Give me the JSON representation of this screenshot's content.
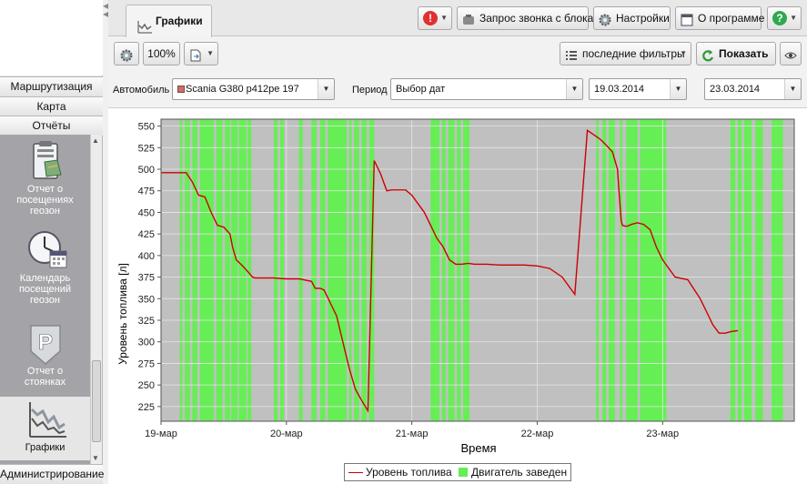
{
  "sidebar": {
    "sections": [
      "Маршрутизация",
      "Карта",
      "Отчёты"
    ],
    "items": [
      {
        "label": "Отчет о посещениях геозон",
        "icon": "clipboard-map-icon"
      },
      {
        "label": "Календарь посещений геозон",
        "icon": "clock-calendar-icon"
      },
      {
        "label": "Отчет о стоянках",
        "icon": "parking-sign-icon"
      },
      {
        "label": "Графики",
        "icon": "line-chart-icon"
      }
    ],
    "bottom_section": "Администрирование"
  },
  "tabs": [
    {
      "label": "Графики",
      "icon": "chart-icon"
    }
  ],
  "top_toolbar": {
    "alert_icon": "red-exclamation-icon",
    "call_request_label": "Запрос звонка с блока",
    "settings_label": "Настройки",
    "about_label": "О программе",
    "help_icon": "green-question-icon"
  },
  "chart_toolbar": {
    "settings_icon": "gear-icon",
    "zoom_label": "100%",
    "export_icon": "export-document-icon",
    "filters_label": "последние фильтры",
    "show_label": "Показать",
    "view_icon": "eye-icon"
  },
  "filters": {
    "vehicle_label": "Автомобиль",
    "vehicle_value": "Scania G380 p412pe 197",
    "vehicle_color": "#c87070",
    "period_label": "Период",
    "period_value": "Выбор дат",
    "date_from": "19.03.2014",
    "date_to": "23.03.2014"
  },
  "legend": {
    "fuel_label": "Уровень топлива",
    "engine_label": "Двигатель заведен"
  },
  "chart_data": {
    "type": "line",
    "xlabel": "Время",
    "ylabel": "Уровень топлива [л]",
    "x_ticks": [
      "19-мар",
      "20-мар",
      "21-мар",
      "22-мар",
      "23-мар"
    ],
    "y_ticks": [
      225,
      250,
      275,
      300,
      325,
      350,
      375,
      400,
      425,
      450,
      475,
      500,
      525,
      550
    ],
    "xlim_days": [
      0,
      5.05
    ],
    "ylim": [
      208,
      558
    ],
    "grid": true,
    "colors": {
      "fuel": "#cc0000",
      "engine": "#66ee55",
      "background": "#c0c0c0"
    },
    "series": [
      {
        "name": "Уровень топлива",
        "x_days": [
          0,
          0.2,
          0.25,
          0.3,
          0.35,
          0.4,
          0.45,
          0.5,
          0.55,
          0.57,
          0.6,
          0.65,
          0.7,
          0.73,
          0.75,
          0.8,
          0.85,
          0.9,
          1.0,
          1.1,
          1.2,
          1.23,
          1.27,
          1.3,
          1.35,
          1.4,
          1.45,
          1.5,
          1.55,
          1.6,
          1.65,
          1.7,
          1.75,
          1.8,
          1.84,
          1.846,
          1.85,
          1.87,
          1.9,
          1.95,
          2.0,
          2.1,
          2.2,
          2.25,
          2.3,
          2.35,
          2.4,
          2.45,
          2.5,
          2.55,
          2.6,
          2.7,
          2.8,
          2.9,
          3.0,
          3.1,
          3.2,
          3.3,
          3.4,
          3.5,
          3.55,
          3.6,
          3.64,
          3.65,
          3.66,
          3.67,
          3.68,
          3.7,
          3.72,
          3.75,
          3.8,
          3.85,
          3.9,
          3.95,
          4.0,
          4.1,
          4.2,
          4.3,
          4.35,
          4.4,
          4.45,
          4.5,
          4.55,
          4.6,
          4.65,
          4.7,
          4.75,
          4.8,
          4.85,
          4.88,
          4.95,
          5.0
        ],
        "y": [
          496,
          496,
          485,
          470,
          468,
          450,
          435,
          433,
          425,
          410,
          395,
          388,
          380,
          375,
          374,
          374,
          374,
          374,
          373,
          373,
          370,
          362,
          362,
          360,
          345,
          330,
          300,
          270,
          245,
          232,
          220,
          510,
          495,
          475,
          476,
          476,
          476,
          476,
          476,
          476,
          470,
          450,
          420,
          410,
          395,
          390,
          390,
          391,
          390,
          390,
          390,
          389,
          389,
          389,
          388,
          385,
          375,
          355,
          545,
          535,
          528,
          520,
          500,
          480,
          460,
          440,
          435,
          434,
          434,
          436,
          438,
          436,
          430,
          410,
          395,
          375,
          372,
          350,
          335,
          320,
          310,
          310,
          312,
          313
        ]
      },
      {
        "name": "Двигатель заведен",
        "intervals_days": [
          [
            0.15,
            0.17
          ],
          [
            0.19,
            0.23
          ],
          [
            0.25,
            0.29
          ],
          [
            0.31,
            0.42
          ],
          [
            0.44,
            0.49
          ],
          [
            0.51,
            0.55
          ],
          [
            0.56,
            0.61
          ],
          [
            0.62,
            0.68
          ],
          [
            0.69,
            0.72
          ],
          [
            0.9,
            0.93
          ],
          [
            0.95,
            0.98
          ],
          [
            1.1,
            1.13
          ],
          [
            1.2,
            1.24
          ],
          [
            1.27,
            1.31
          ],
          [
            1.33,
            1.48
          ],
          [
            1.5,
            1.52
          ],
          [
            1.54,
            1.58
          ],
          [
            1.6,
            1.64
          ],
          [
            1.66,
            1.7
          ],
          [
            2.15,
            2.22
          ],
          [
            2.24,
            2.27
          ],
          [
            2.29,
            2.34
          ],
          [
            2.36,
            2.39
          ],
          [
            2.41,
            2.46
          ],
          [
            3.47,
            3.49
          ],
          [
            3.52,
            3.55
          ],
          [
            3.57,
            3.62
          ],
          [
            3.66,
            3.68
          ],
          [
            3.71,
            3.8
          ],
          [
            3.82,
            4.03
          ],
          [
            4.54,
            4.58
          ],
          [
            4.6,
            4.63
          ],
          [
            4.65,
            4.71
          ],
          [
            4.74,
            4.8
          ],
          [
            4.87,
            4.96
          ]
        ]
      }
    ]
  }
}
